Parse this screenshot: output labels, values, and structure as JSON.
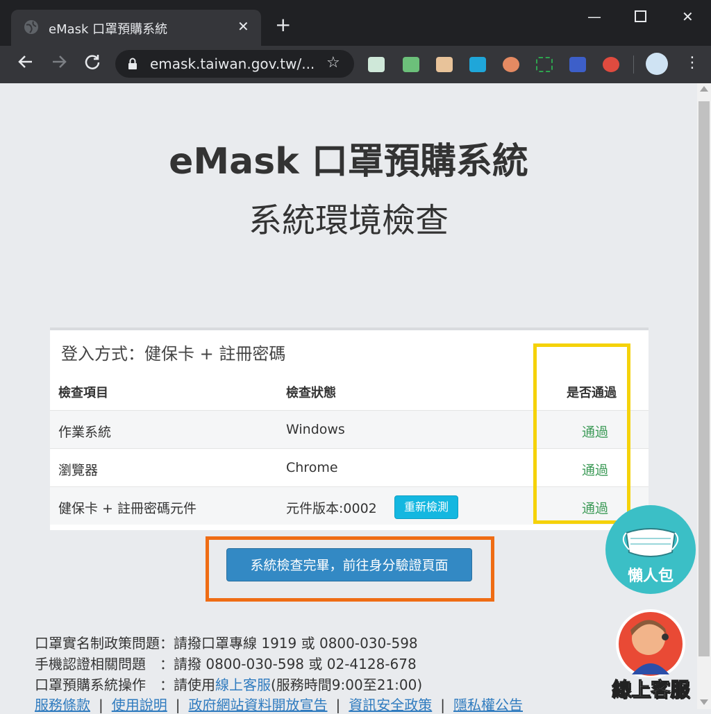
{
  "browser": {
    "tab_title": "eMask 口罩預購系統",
    "tab_close": "✕",
    "new_tab": "+",
    "url": "emask.taiwan.gov.tw/...",
    "minimize": "—",
    "close": "✕"
  },
  "page": {
    "title": "eMask 口罩預購系統",
    "subtitle": "系統環境檢查"
  },
  "panel": {
    "heading": "登入方式：健保卡 + 註冊密碼",
    "columns": [
      "檢查項目",
      "檢查狀態",
      "是否通過"
    ],
    "rows": [
      {
        "item": "作業系統",
        "status": "Windows",
        "result": "通過"
      },
      {
        "item": "瀏覽器",
        "status": "Chrome",
        "result": "通過"
      },
      {
        "item": "健保卡 + 註冊密碼元件",
        "status": "元件版本:0002",
        "result": "通過",
        "action": "重新檢測"
      }
    ]
  },
  "next_button": "系統檢查完畢，前往身分驗證頁面",
  "footer": {
    "line1": "口罩實名制政策問題：請撥口罩專線 1919 或 0800-030-598",
    "line2": "手機認證相關問題　：請撥 0800-030-598 或 02-4128-678",
    "line3_prefix": "口罩預購系統操作　：請使用",
    "line3_link": "線上客服",
    "line3_suffix": "(服務時間9:00至21:00)",
    "links": [
      "服務條款",
      "使用說明",
      "政府網站資料開放宣告",
      "資訊安全政策",
      "隱私權公告"
    ],
    "separator": "|"
  },
  "badges": {
    "guide": "懶人包",
    "support": "線上客服"
  },
  "colors": {
    "highlight_yellow": "#f5d20a",
    "highlight_orange": "#ef6c14",
    "button_blue": "#3389c4",
    "pass_green": "#3c9a57",
    "recheck_cyan": "#14b7e0"
  }
}
